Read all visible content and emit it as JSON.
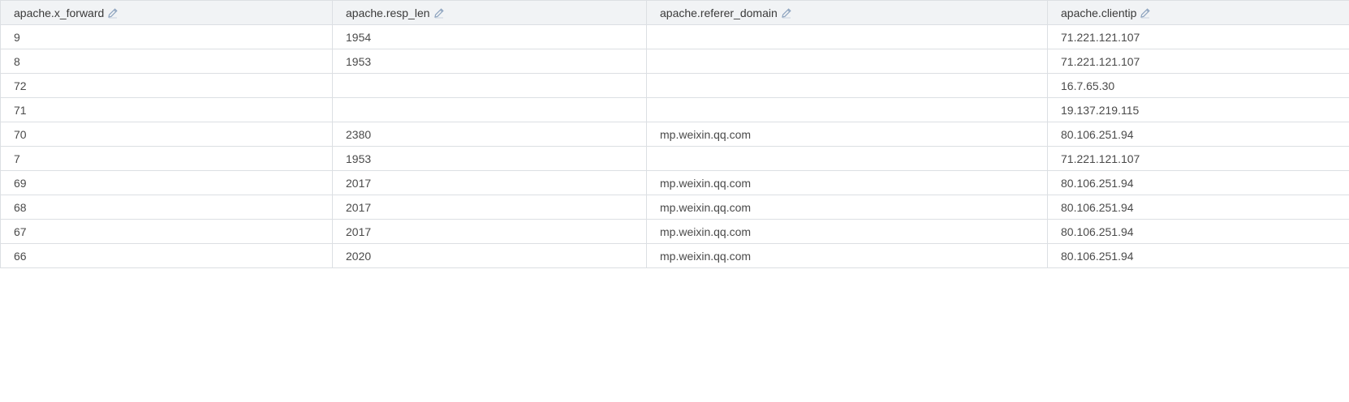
{
  "table": {
    "columns": [
      {
        "label": "apache.x_forward",
        "icon": "pencil-icon"
      },
      {
        "label": "apache.resp_len",
        "icon": "pencil-icon"
      },
      {
        "label": "apache.referer_domain",
        "icon": "pencil-icon"
      },
      {
        "label": "apache.clientip",
        "icon": "pencil-icon"
      }
    ],
    "rows": [
      [
        "9",
        "1954",
        "",
        "71.221.121.107"
      ],
      [
        "8",
        "1953",
        "",
        "71.221.121.107"
      ],
      [
        "72",
        "",
        "",
        "16.7.65.30"
      ],
      [
        "71",
        "",
        "",
        "19.137.219.115"
      ],
      [
        "70",
        "2380",
        "mp.weixin.qq.com",
        "80.106.251.94"
      ],
      [
        "7",
        "1953",
        "",
        "71.221.121.107"
      ],
      [
        "69",
        "2017",
        "mp.weixin.qq.com",
        "80.106.251.94"
      ],
      [
        "68",
        "2017",
        "mp.weixin.qq.com",
        "80.106.251.94"
      ],
      [
        "67",
        "2017",
        "mp.weixin.qq.com",
        "80.106.251.94"
      ],
      [
        "66",
        "2020",
        "mp.weixin.qq.com",
        "80.106.251.94"
      ]
    ]
  },
  "colors": {
    "header_bg": "#f1f3f5",
    "border": "#dcdfe3",
    "icon": "#8ea4bf"
  }
}
